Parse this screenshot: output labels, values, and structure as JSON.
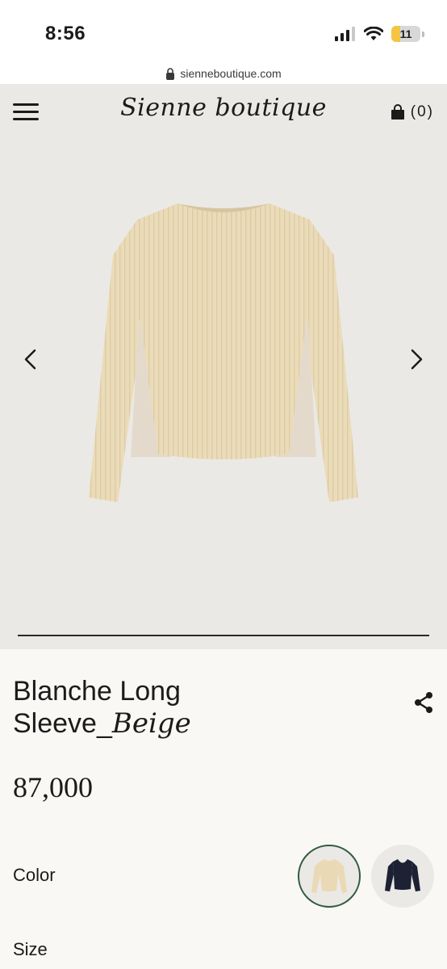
{
  "status_bar": {
    "time": "8:56",
    "battery": "11"
  },
  "browser": {
    "url": "sienneboutique.com"
  },
  "header": {
    "logo": "Sienne boutique",
    "cart_count": "(0)"
  },
  "product": {
    "title_main": "Blanche Long Sleeve_",
    "title_italic": "Beige",
    "price": "87,000",
    "color_label": "Color",
    "size_label": "Size",
    "color_options": [
      "beige",
      "navy"
    ],
    "gallery_progress": 1.0
  },
  "icons": [
    "lock-icon",
    "menu-icon",
    "bag-icon",
    "chevron-left-icon",
    "chevron-right-icon",
    "share-icon",
    "signal-icon",
    "wifi-icon"
  ],
  "colors": {
    "accent_selected": "#2f5a44",
    "background": "#ebe9e5",
    "beige": "#eadbb8",
    "navy": "#1c2233"
  }
}
